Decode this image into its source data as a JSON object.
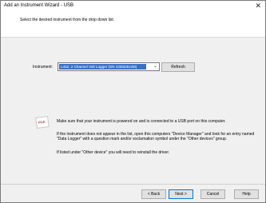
{
  "window": {
    "title": "Add an Instrument Wizard - USB",
    "close_glyph": "✕"
  },
  "header": {
    "instruction": "Select the desired instrument from the drop down list."
  },
  "instrument": {
    "label": "Instrument:",
    "selected": "L452, 2 Channel Volt Logger (SN 133633U2M)",
    "refresh_label": "Refresh"
  },
  "info": {
    "icon_text": "FILE",
    "line1": "Make sure that your instrument is powered on and is connected to a USB port on this computer.",
    "line2": "If the instrument does not appear in the list, open this computers \"Device Manager\" and look for an entry named \"Data Logger\" with a question mark and/or exclamation symbol under the \"Other devices\" group.",
    "line3": "If listed under \"Other device\" you will need to reinstall the driver."
  },
  "footer": {
    "back_label": "< Back",
    "next_label": "Next >",
    "cancel_label": "Cancel",
    "help_label": "Help"
  }
}
